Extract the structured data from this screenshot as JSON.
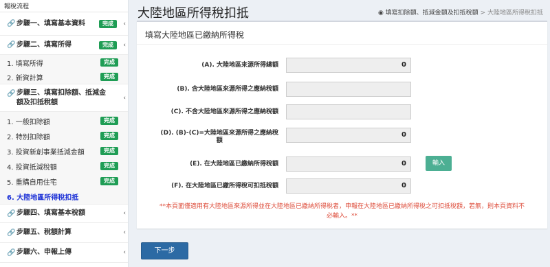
{
  "sidebar": {
    "title": "報稅流程",
    "steps": [
      {
        "label": "步驟一、填寫基本資料",
        "badge": "完成"
      },
      {
        "label": "步驟二、填寫所得",
        "badge": "完成"
      },
      {
        "label": "步驟三、填寫扣除額、抵減金額及扣抵稅額"
      },
      {
        "label": "步驟四、填寫基本稅額"
      },
      {
        "label": "步驟五、稅額計算"
      },
      {
        "label": "步驟六、申報上傳"
      }
    ],
    "step2_items": [
      {
        "label": "1. 填寫所得",
        "badge": "完成"
      },
      {
        "label": "2. 新資計算",
        "badge": "完成"
      }
    ],
    "step3_items": [
      {
        "label": "1. 一般扣除額",
        "badge": "完成"
      },
      {
        "label": "2. 特別扣除額",
        "badge": "完成"
      },
      {
        "label": "3. 投資新創事業抵減金額",
        "badge": "完成"
      },
      {
        "label": "4. 投資抵減稅額",
        "badge": "完成"
      },
      {
        "label": "5. 重購自用住宅",
        "badge": "完成"
      },
      {
        "label": "6. 大陸地區所得稅扣抵"
      }
    ],
    "chevron": "‹"
  },
  "header": {
    "title": "大陸地區所得稅扣抵",
    "breadcrumb_icon": "dashboard-icon",
    "breadcrumb_1": "填寫扣除額、抵減金額及扣抵稅額",
    "breadcrumb_sep": ">",
    "breadcrumb_2": "大陸地區所得稅扣抵"
  },
  "panel": {
    "heading": "填寫大陸地區已繳納所得稅",
    "rows": [
      {
        "label": "(A). 大陸地區來源所得總額",
        "value": "0"
      },
      {
        "label": "(B). 含大陸地區來源所得之應納稅額",
        "value": ""
      },
      {
        "label": "(C). 不含大陸地區來源所得之應納稅額",
        "value": ""
      },
      {
        "label_line1": "(D). (B)-(C)=大陸地區來源所得之應納稅",
        "label_line2": "額",
        "value": "0"
      },
      {
        "label": "(E). 在大陸地區已繳納所得稅額",
        "value": "0"
      },
      {
        "label": "(F). 在大陸地區已繳所得稅可扣抵稅額",
        "value": "0"
      }
    ],
    "input_button": "輸入",
    "note_line1": "**本頁面僅適用有大陸地區來源所得並在大陸地區已繳納所得稅者，申報在大陸地區已繳納所得稅之可扣抵稅額，若無，則本頁資料不",
    "note_line2": "必輸入。**"
  },
  "footer": {
    "next_button": "下一步"
  },
  "colors": {
    "badge": "#1f9d55",
    "active_link": "#1a2fd6",
    "next_button": "#2c6aa4",
    "input_button": "#4caf93",
    "note": "#dd4b39"
  }
}
